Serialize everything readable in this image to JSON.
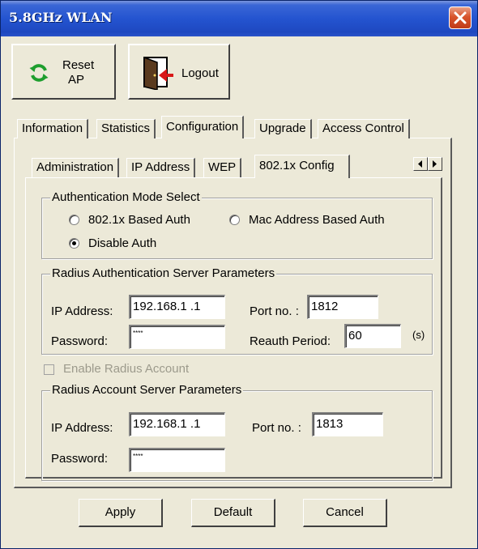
{
  "window": {
    "title": "5.8GHz WLAN"
  },
  "toolbar": {
    "reset_label_line1": "Reset",
    "reset_label_line2": "AP",
    "logout_label": "Logout"
  },
  "main_tabs": [
    "Information",
    "Statistics",
    "Configuration",
    "Upgrade",
    "Access Control"
  ],
  "sub_tabs": [
    "Administration",
    "IP Address",
    "WEP",
    "802.1x Config"
  ],
  "auth_mode": {
    "title": "Authentication Mode Select",
    "options": [
      "802.1x Based Auth",
      "Mac Address Based Auth",
      "Disable Auth"
    ],
    "selected": "Disable Auth"
  },
  "radius_auth": {
    "title": "Radius Authentication Server Parameters",
    "ip_label": "IP Address:",
    "ip_value": "192.168.1  .1",
    "port_label": "Port no. :",
    "port_value": "1812",
    "password_label": "Password:",
    "password_value": "****",
    "reauth_label": "Reauth Period:",
    "reauth_value": "60",
    "reauth_unit": "(s)"
  },
  "enable_account": {
    "label": "Enable Radius Account",
    "checked": false,
    "disabled": true
  },
  "radius_account": {
    "title": "Radius Account Server Parameters",
    "ip_label": "IP Address:",
    "ip_value": "192.168.1  .1",
    "port_label": "Port no. :",
    "port_value": "1813",
    "password_label": "Password:",
    "password_value": "****"
  },
  "buttons": {
    "apply": "Apply",
    "default": "Default",
    "cancel": "Cancel"
  }
}
